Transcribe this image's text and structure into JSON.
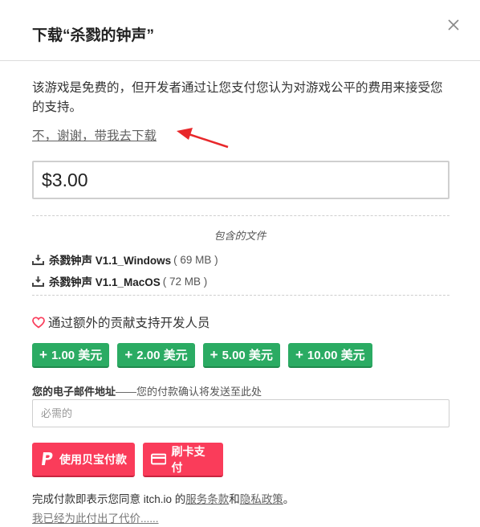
{
  "dialog": {
    "title": "下载“杀戮的钟声”",
    "close_icon": "close-icon"
  },
  "intro_text": "该游戏是免费的，但开发者通过让您支付您认为对游戏公平的费用来接受您的支持。",
  "skip_link": "不，谢谢，带我去下载",
  "price": {
    "value": "$3.00"
  },
  "files": {
    "heading": "包含的文件",
    "items": [
      {
        "name": "杀戮钟声 V1.1_Windows",
        "size": "( 69 MB )",
        "icon": "download-icon"
      },
      {
        "name": "杀戮钟声 V1.1_MacOS",
        "size": "( 72 MB )",
        "icon": "download-icon"
      }
    ]
  },
  "support": {
    "label": "通过额外的贡献支持开发人员",
    "icon": "heart-icon",
    "tips": [
      "1.00 美元",
      "2.00 美元",
      "5.00 美元",
      "10.00 美元"
    ]
  },
  "email": {
    "label": "您的电子邮件地址",
    "hint": "——您的付款确认将发送至此处",
    "placeholder": "必需的",
    "value": ""
  },
  "payment": {
    "paypal_label": "使用贝宝付款",
    "card_label": "刷卡支付",
    "paypal_icon": "paypal-icon",
    "card_icon": "credit-card-icon"
  },
  "terms": {
    "prefix": "完成付款即表示您同意 itch.io 的",
    "tos_link": "服务条款",
    "and": "和",
    "privacy_link": "隐私政策",
    "suffix": "。"
  },
  "already_paid": "我已经为此付出了代价......",
  "colors": {
    "accent_green": "#2bab63",
    "pay_red": "#fa3c5a",
    "arrow_red": "#e8282b"
  }
}
